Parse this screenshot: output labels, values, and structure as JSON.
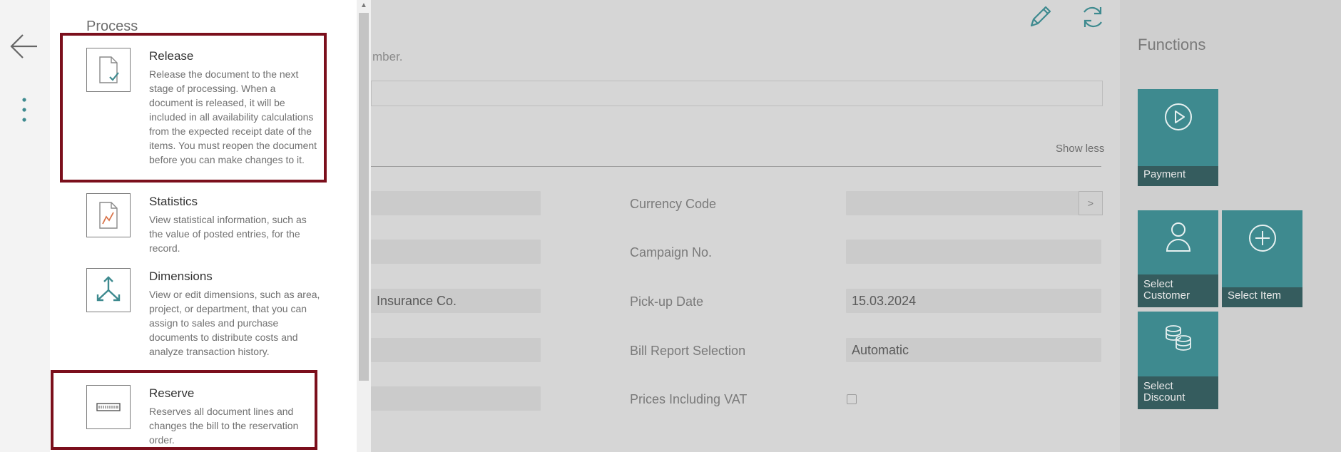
{
  "main": {
    "hint_text": "mber.",
    "show_less": "Show less",
    "left_values": [
      "",
      "",
      "Insurance Co.",
      "",
      ""
    ],
    "right_fields": [
      {
        "label": "Currency Code",
        "value": ""
      },
      {
        "label": "Campaign No.",
        "value": ""
      },
      {
        "label": "Pick-up Date",
        "value": "15.03.2024"
      },
      {
        "label": "Bill Report Selection",
        "value": "Automatic"
      },
      {
        "label": "Prices Including VAT",
        "value": ""
      }
    ],
    "lookup_label": ">"
  },
  "toolbar": {
    "icons": [
      "edit-pencil-icon",
      "refresh-icon"
    ]
  },
  "functions": {
    "title": "Functions",
    "tiles": [
      {
        "label": "Payment",
        "icon": "play-circle-icon"
      },
      {
        "label": "Select Customer",
        "icon": "person-icon"
      },
      {
        "label": "Select Item",
        "icon": "plus-circle-icon"
      },
      {
        "label": "Select Discount",
        "icon": "coins-icon"
      }
    ]
  },
  "rail": {
    "icons": [
      "back-arrow-icon",
      "more-vertical-icon"
    ]
  },
  "panel": {
    "title": "Process",
    "actions": [
      {
        "title": "Release",
        "description": "Release the document to the next stage of processing. When a document is released, it will be included in all availability calculations from the expected receipt date of the items. You must reopen the document before you can make changes to it.",
        "icon": "release-document-icon"
      },
      {
        "title": "Statistics",
        "description": "View statistical information, such as the value of posted entries, for the record.",
        "icon": "statistics-chart-icon"
      },
      {
        "title": "Dimensions",
        "description": "View or edit dimensions, such as area, project, or department, that you can assign to sales and purchase documents to distribute costs and analyze transaction history.",
        "icon": "dimensions-arrows-icon"
      },
      {
        "title": "Reserve",
        "description": "Reserves all document lines and changes the bill to the reservation order.",
        "icon": "reserve-icon"
      }
    ]
  },
  "colors": {
    "highlight": "#7b0f1c",
    "tile": "#3e8a8f",
    "tile_label": "#355c5e"
  }
}
